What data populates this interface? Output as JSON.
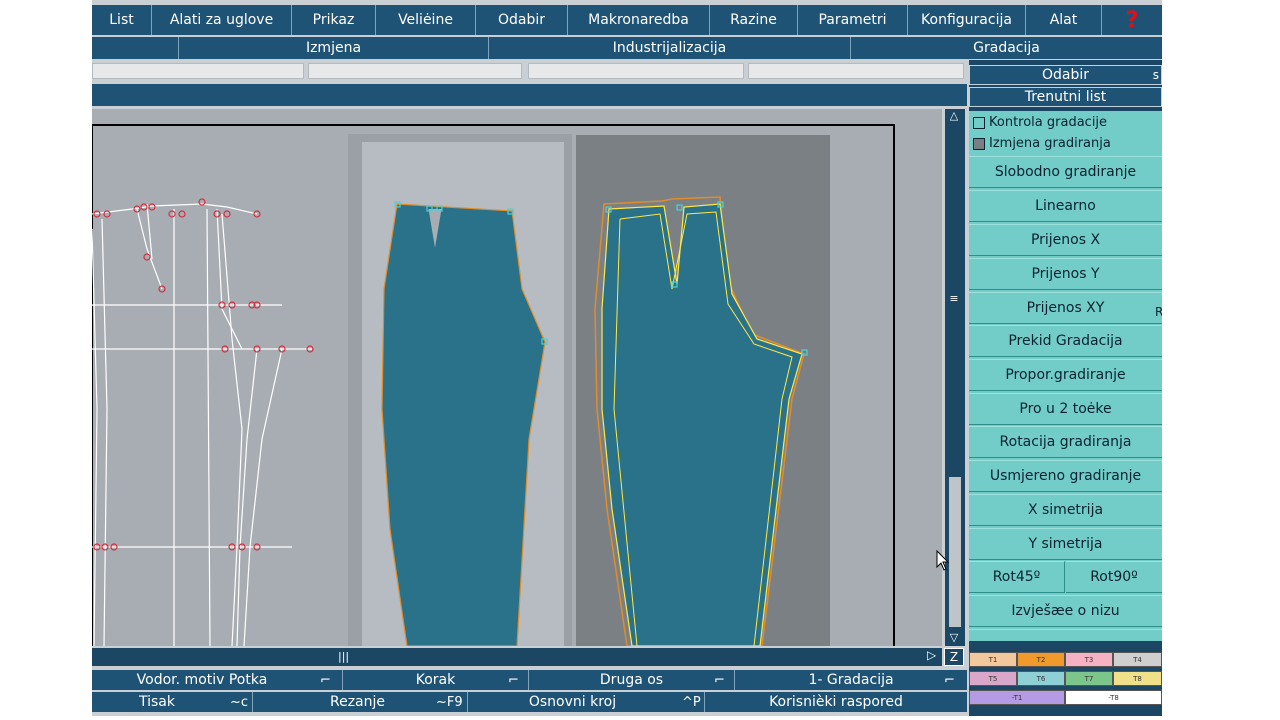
{
  "menu": {
    "items": [
      "List",
      "Alati za uglove",
      "Prikaz",
      "Veliėine",
      "Odabir",
      "Makronaredba",
      "Razine",
      "Parametri",
      "Konfiguracija",
      "Alat"
    ]
  },
  "submenu": {
    "items": [
      "Izmjena",
      "Industrijalizacija",
      "Gradacija"
    ]
  },
  "right_panel": {
    "header1": "Odabir",
    "header1_suffix": "s",
    "header2": "Trenutni list",
    "checks": [
      "Kontrola gradacije",
      "Izmjena gradiranja"
    ],
    "buttons": [
      "Slobodno gradiranje",
      "Linearno",
      "Prijenos X",
      "Prijenos Y",
      "Prijenos XY",
      "Prekid Gradacija",
      "Propor.gradiranje",
      "Pro u 2 toėke",
      "Rotacija gradiranja",
      "Usmjereno gradiranje",
      "X simetrija",
      "Y simetrija"
    ],
    "rot45": "Rot45º",
    "rot90": "Rot90º",
    "last_button": "Izvješæe o nizu",
    "side_char": "R"
  },
  "bottom_row1": {
    "c1": "Vodor. motiv Potka",
    "c2": "Korak",
    "c3": "Druga os",
    "c4": "1- Gradacija"
  },
  "bottom_row2": {
    "c1": "Tisak",
    "c1k": "~c",
    "c2": "Rezanje",
    "c2k": "~F9",
    "c3": "Osnovni kroj",
    "c3k": "^P",
    "c4": "Korisnièki raspored"
  },
  "scroll": {
    "z": "Z"
  },
  "swatches": [
    {
      "label": "T1",
      "color": "#f3c89d"
    },
    {
      "label": "T2",
      "color": "#f09a2c"
    },
    {
      "label": "T3",
      "color": "#f4b2c4"
    },
    {
      "label": "T4",
      "color": "#cfcfcf"
    },
    {
      "label": "T5",
      "color": "#d8a7c9"
    },
    {
      "label": "T6",
      "color": "#8fd0d6"
    },
    {
      "label": "T7",
      "color": "#7cc68b"
    },
    {
      "label": "T8",
      "color": "#f1e08a"
    },
    {
      "label": "-T1",
      "color": "#b59be3"
    },
    {
      "label": "-T8",
      "color": "#ffffff"
    }
  ],
  "colors": {
    "pattern_fill": "#2a728a",
    "panel_bg": "#72cdc8",
    "bar_bg": "#1f5375",
    "help": "#e0101a"
  }
}
